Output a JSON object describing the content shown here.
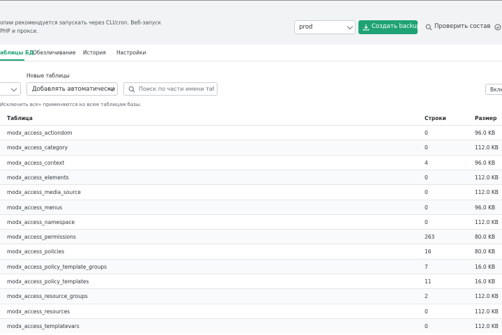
{
  "topbar": {
    "notice_line1": "опии рекомендуется запускать через CLI/cron. Веб-запуск",
    "notice_line2": "PHP и прокси.",
    "env_select_value": "prod",
    "create_backup_label": "Создать backup",
    "check_composition_label": "Проверить состав"
  },
  "tabs": [
    {
      "label": "аблицы БД",
      "active": true
    },
    {
      "label": "Обезличивание",
      "active": false
    },
    {
      "label": "История",
      "active": false
    },
    {
      "label": "Настройки",
      "active": false
    }
  ],
  "filters": {
    "new_tables_label": "Новые таблицы",
    "new_tables_value": "Добавлять автоматически",
    "search_placeholder": "Поиск по части имени табли",
    "include_button": "Вклю"
  },
  "hint": "Исключить все» применяются ко всем таблицам базы.",
  "table": {
    "columns": [
      "Таблица",
      "Строки",
      "Размер"
    ],
    "rows": [
      [
        "modx_access_actiondom",
        "0",
        "96.0 KB"
      ],
      [
        "modx_access_category",
        "0",
        "112.0 KB"
      ],
      [
        "modx_access_context",
        "4",
        "96.0 KB"
      ],
      [
        "modx_access_elements",
        "0",
        "112.0 KB"
      ],
      [
        "modx_access_media_source",
        "0",
        "112.0 KB"
      ],
      [
        "modx_access_menus",
        "0",
        "96.0 KB"
      ],
      [
        "modx_access_namespace",
        "0",
        "112.0 KB"
      ],
      [
        "modx_access_permissions",
        "263",
        "80.0 KB"
      ],
      [
        "modx_access_policies",
        "16",
        "80.0 KB"
      ],
      [
        "modx_access_policy_template_groups",
        "7",
        "16.0 KB"
      ],
      [
        "modx_access_policy_templates",
        "11",
        "16.0 KB"
      ],
      [
        "modx_access_resource_groups",
        "2",
        "112.0 KB"
      ],
      [
        "modx_access_resources",
        "0",
        "112.0 KB"
      ],
      [
        "modx_access_templatevars",
        "0",
        "112.0 KB"
      ]
    ]
  },
  "colors": {
    "accent": "#1fa374",
    "topbar_bg": "#f2f3f5",
    "border": "#c9ced3"
  }
}
